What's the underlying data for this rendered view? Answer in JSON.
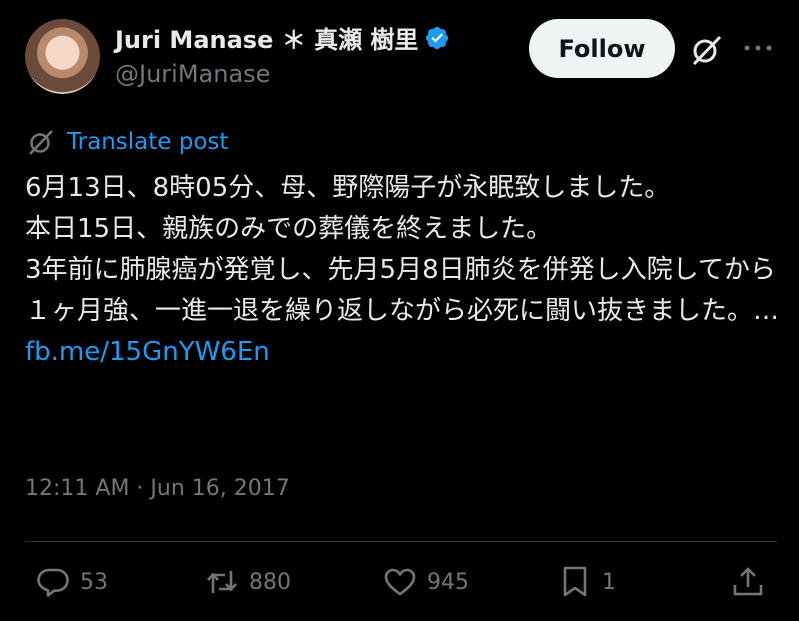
{
  "author": {
    "display_name": "Juri Manase ＊ 真瀬 樹里",
    "handle": "@JuriManase",
    "verified": true
  },
  "follow_label": "Follow",
  "translate_label": "Translate post",
  "post": {
    "text": "6月13日、8時05分、母、野際陽子が永眠致しました。\n本日15日、親族のみでの葬儀を終えました。\n3年前に肺腺癌が発覚し、先月5月8日肺炎を併発し入院してから１ヶ月強、一進一退を繰り返しながら必死に闘い抜きました。… ",
    "link": "fb.me/15GnYW6En"
  },
  "timestamp": "12:11 AM · Jun 16, 2017",
  "actions": {
    "replies": "53",
    "reposts": "880",
    "likes": "945",
    "bookmarks": "1"
  },
  "colors": {
    "background": "#000000",
    "text": "#e7e9ea",
    "muted": "#71767b",
    "link": "#1d9bf0",
    "verified": "#1d9bf0"
  },
  "icons": [
    "verified-badge-icon",
    "grok-icon",
    "more-icon",
    "translate-icon",
    "reply-icon",
    "repost-icon",
    "like-icon",
    "bookmark-icon",
    "share-icon"
  ]
}
